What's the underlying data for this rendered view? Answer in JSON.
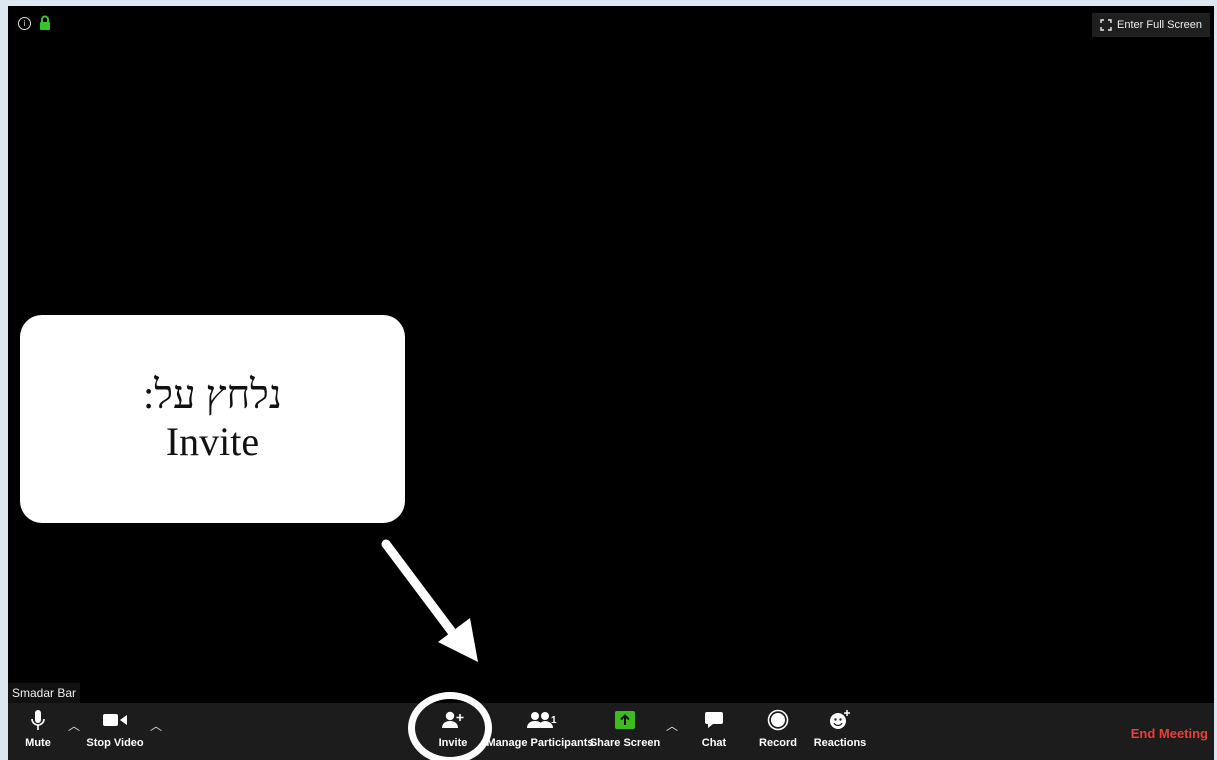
{
  "topbar": {
    "fullscreen_label": "Enter Full Screen"
  },
  "callout": {
    "line1": "נלחץ על:",
    "line2": "Invite"
  },
  "participant": {
    "name": "Smadar Bar"
  },
  "toolbar": {
    "mute_label": "Mute",
    "stop_video_label": "Stop Video",
    "invite_label": "Invite",
    "participants_label": "Manage Participants",
    "participants_count": "1",
    "share_label": "Share Screen",
    "chat_label": "Chat",
    "record_label": "Record",
    "reactions_label": "Reactions",
    "end_label": "End Meeting"
  },
  "colors": {
    "share_green": "#3dbb21",
    "end_red": "#e8403a",
    "lock_green": "#39c32a"
  }
}
